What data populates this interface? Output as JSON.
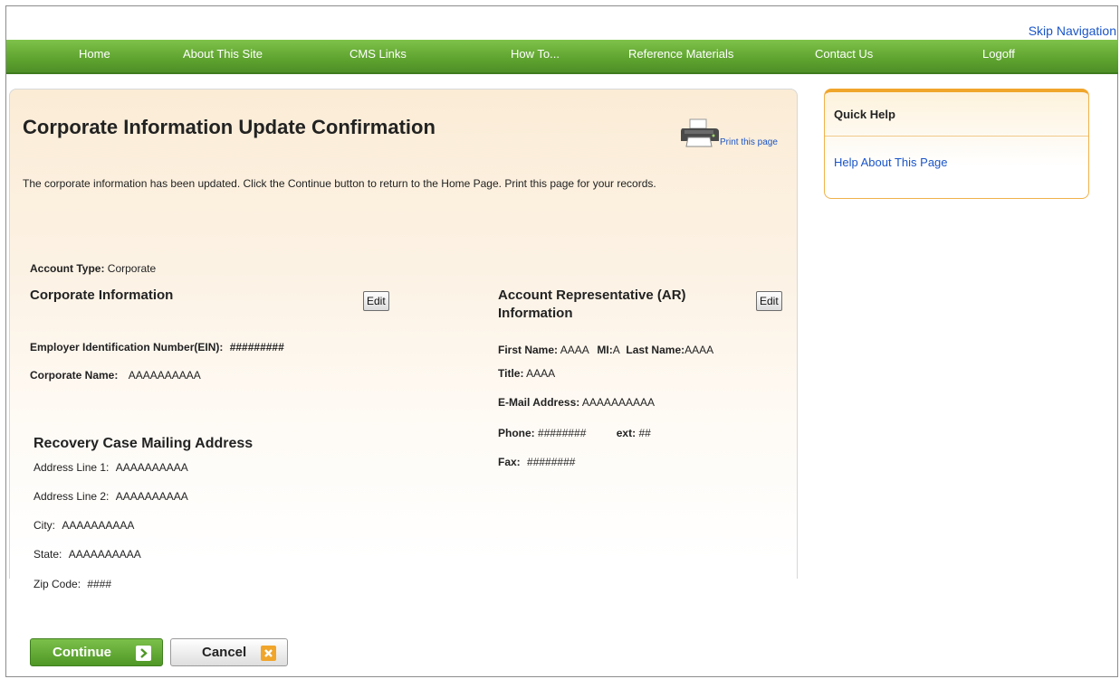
{
  "skip_navigation": "Skip Navigation",
  "nav": {
    "home": "Home",
    "about": "About This Site",
    "cms_links": "CMS Links",
    "how_to": "How To...",
    "reference": "Reference Materials",
    "contact": "Contact Us",
    "logoff": "Logoff"
  },
  "page": {
    "title": "Corporate Information Update Confirmation",
    "print_link": "Print this page",
    "intro": "The corporate information has been updated. Click the Continue button to return to the Home Page. Print this page for your records."
  },
  "account_type": {
    "label": "Account Type:",
    "value": "Corporate"
  },
  "corporate": {
    "heading": "Corporate Information",
    "edit": "Edit",
    "ein_label": "Employer Identification Number(EIN):",
    "ein_value": "#########",
    "name_label": "Corporate Name:",
    "name_value": "AAAAAAAAAA"
  },
  "mailing": {
    "heading": "Recovery Case Mailing Address",
    "line1_label": "Address Line 1:",
    "line1_value": "AAAAAAAAAA",
    "line2_label": "Address Line 2:",
    "line2_value": "AAAAAAAAAA",
    "city_label": "City:",
    "city_value": "AAAAAAAAAA",
    "state_label": "State:",
    "state_value": "AAAAAAAAAA",
    "zip_label": "Zip Code:",
    "zip_value": "####"
  },
  "ar": {
    "heading_line1": "Account Representative (AR)",
    "heading_line2": "Information",
    "edit": "Edit",
    "first_label": "First Name:",
    "first_value": "AAAA",
    "mi_label": "MI:",
    "mi_value": "A",
    "last_label": "Last Name:",
    "last_value": "AAAA",
    "title_label": "Title:",
    "title_value": "AAAA",
    "email_label": "E-Mail Address:",
    "email_value": "AAAAAAAAAA",
    "phone_label": "Phone:",
    "phone_value": "########",
    "ext_label": "ext:",
    "ext_value": "##",
    "fax_label": "Fax:",
    "fax_value": "########"
  },
  "quick_help": {
    "title": "Quick Help",
    "link": "Help About This Page"
  },
  "buttons": {
    "continue": "Continue",
    "cancel": "Cancel"
  },
  "colors": {
    "nav_green": "#5ea32f",
    "link_blue": "#1a55c8",
    "cancel_icon": "#f0a52b"
  }
}
